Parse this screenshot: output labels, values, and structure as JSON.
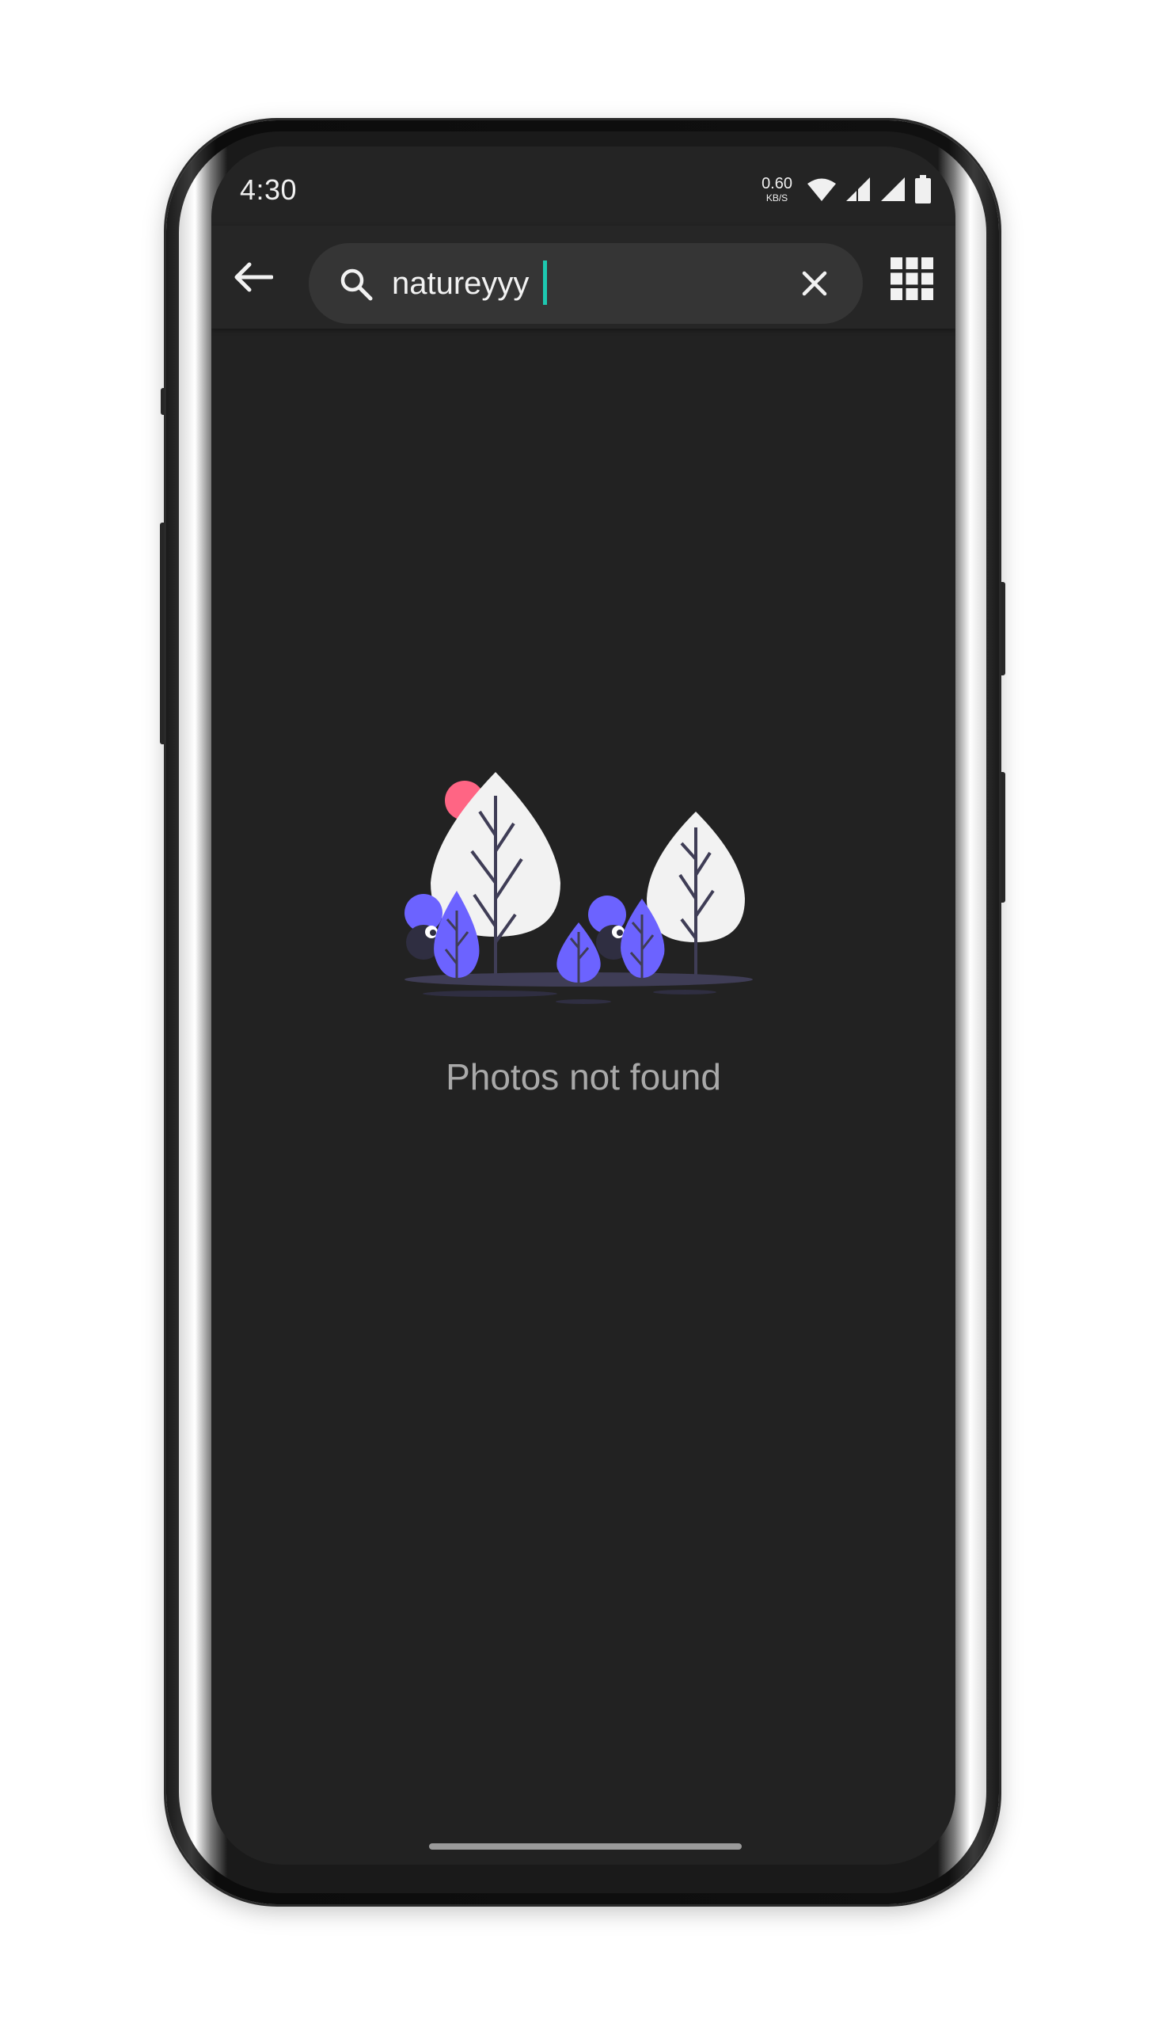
{
  "status_bar": {
    "time": "4:30",
    "net_speed_value": "0.60",
    "net_speed_unit": "KB/S",
    "icons": [
      "wifi-icon",
      "signal-icon",
      "signal-icon",
      "battery-icon"
    ]
  },
  "toolbar": {
    "back_icon": "back-arrow-icon",
    "search_icon": "search-icon",
    "search_value": "natureyyy",
    "clear_icon": "close-icon",
    "layout_icon": "grid-view-icon"
  },
  "empty_state": {
    "illustration": "trees-illustration",
    "message": "Photos not found"
  },
  "colors": {
    "background": "#222222",
    "accent_caret": "#1ec8b0",
    "illustration_purple": "#6c63ff",
    "illustration_pink": "#ff6584",
    "message_text": "#a9a9a9"
  }
}
